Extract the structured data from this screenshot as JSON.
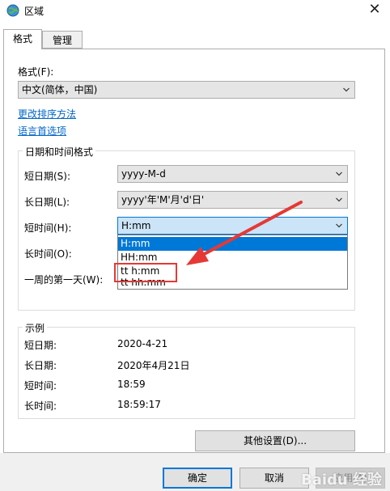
{
  "window": {
    "title": "区域",
    "close": "✕"
  },
  "tabs": [
    {
      "label": "格式"
    },
    {
      "label": "管理"
    }
  ],
  "format": {
    "label": "格式(F):",
    "value": "中文(简体，中国)",
    "links": {
      "sort": "更改排序方法",
      "lang": "语言首选项"
    }
  },
  "datetime": {
    "group_title": "日期和时间格式",
    "short_date": {
      "label": "短日期(S):",
      "value": "yyyy-M-d"
    },
    "long_date": {
      "label": "长日期(L):",
      "value": "yyyy'年'M'月'd'日'"
    },
    "short_time": {
      "label": "短时间(H):",
      "value": "H:mm"
    },
    "long_time": {
      "label": "长时间(O):"
    },
    "first_day": {
      "label": "一周的第一天(W):"
    },
    "dropdown_options": [
      "H:mm",
      "HH:mm",
      "tt h:mm",
      "tt hh:mm"
    ]
  },
  "examples": {
    "group_title": "示例",
    "rows": [
      {
        "label": "短日期:",
        "value": "2020-4-21"
      },
      {
        "label": "长日期:",
        "value": "2020年4月21日"
      },
      {
        "label": "短时间:",
        "value": "18:59"
      },
      {
        "label": "长时间:",
        "value": "18:59:17"
      }
    ]
  },
  "buttons": {
    "other": "其他设置(D)...",
    "ok": "确定",
    "cancel": "取消",
    "apply": "应用(A)"
  },
  "watermark": "Baidu 经验",
  "colors": {
    "accent": "#0078d7",
    "annotation": "#e53935"
  }
}
